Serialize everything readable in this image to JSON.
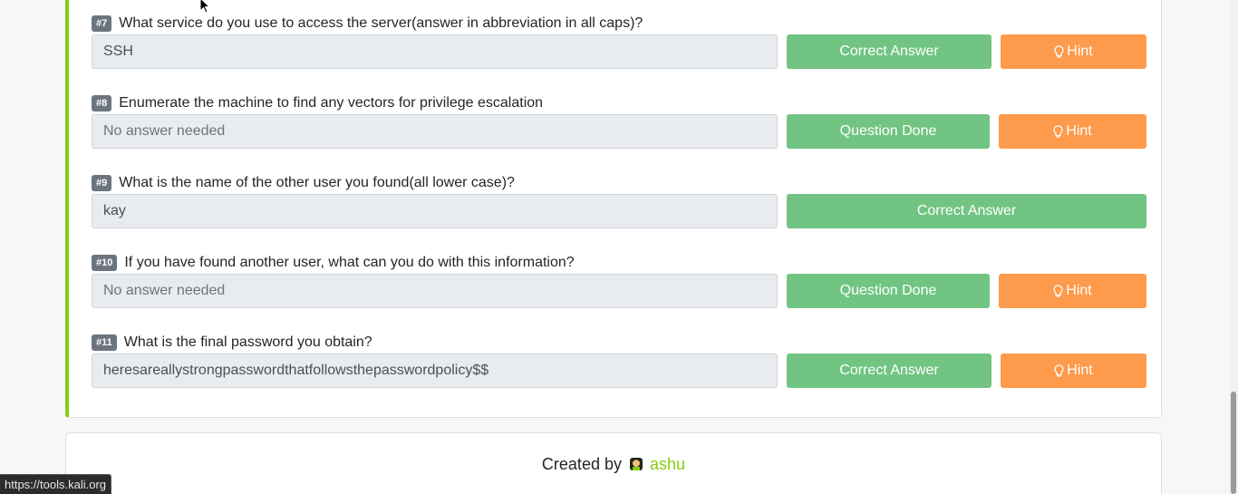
{
  "questions": [
    {
      "num": "#7",
      "text": "What service do you use to access the server(answer in abbreviation in all caps)?",
      "answer": "SSH",
      "placeholder": false,
      "action": "Correct Answer",
      "hint": "Hint"
    },
    {
      "num": "#8",
      "text": "Enumerate the machine to find any vectors for privilege escalation",
      "answer": "No answer needed",
      "placeholder": true,
      "action": "Question Done",
      "hint": "Hint"
    },
    {
      "num": "#9",
      "text": "What is the name of the other user you found(all lower case)?",
      "answer": "kay",
      "placeholder": false,
      "action": "Correct Answer"
    },
    {
      "num": "#10",
      "text": "If you have found another user, what can you do with this information?",
      "answer": "No answer needed",
      "placeholder": true,
      "action": "Question Done",
      "hint": "Hint"
    },
    {
      "num": "#11",
      "text": "What is the final password you obtain?",
      "answer": "heresareallystrongpasswordthatfollowsthepasswordpolicy$$",
      "placeholder": false,
      "action": "Correct Answer",
      "hint": "Hint"
    }
  ],
  "footer": {
    "created_by": "Created by",
    "author": "ashu"
  },
  "status_bar": {
    "url": "https://tools.kali.org"
  },
  "colors": {
    "accent": "#88cc14",
    "success": "#71c482",
    "hint": "#fd9a4b"
  }
}
